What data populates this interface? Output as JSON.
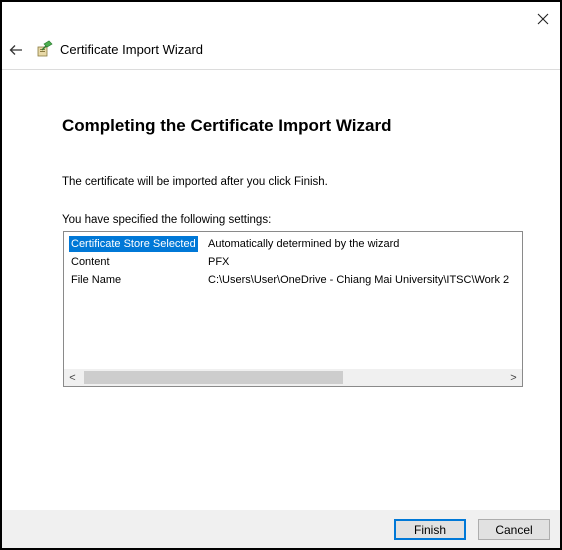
{
  "window": {
    "title": "Certificate Import Wizard"
  },
  "content": {
    "heading": "Completing the Certificate Import Wizard",
    "info_text": "The certificate will be imported after you click Finish.",
    "settings_label": "You have specified the following settings:",
    "settings": [
      {
        "key": "Certificate Store Selected",
        "value": "Automatically determined by the wizard"
      },
      {
        "key": "Content",
        "value": "PFX"
      },
      {
        "key": "File Name",
        "value": "C:\\Users\\User\\OneDrive - Chiang Mai University\\ITSC\\Work 2"
      }
    ],
    "scroll_left_glyph": "<",
    "scroll_right_glyph": ">"
  },
  "footer": {
    "finish_label": "Finish",
    "cancel_label": "Cancel"
  },
  "colors": {
    "selection": "#0078d7",
    "footer_bg": "#f0f0f0"
  },
  "icons": [
    "close-icon",
    "back-arrow-icon",
    "certificate-wizard-icon"
  ]
}
